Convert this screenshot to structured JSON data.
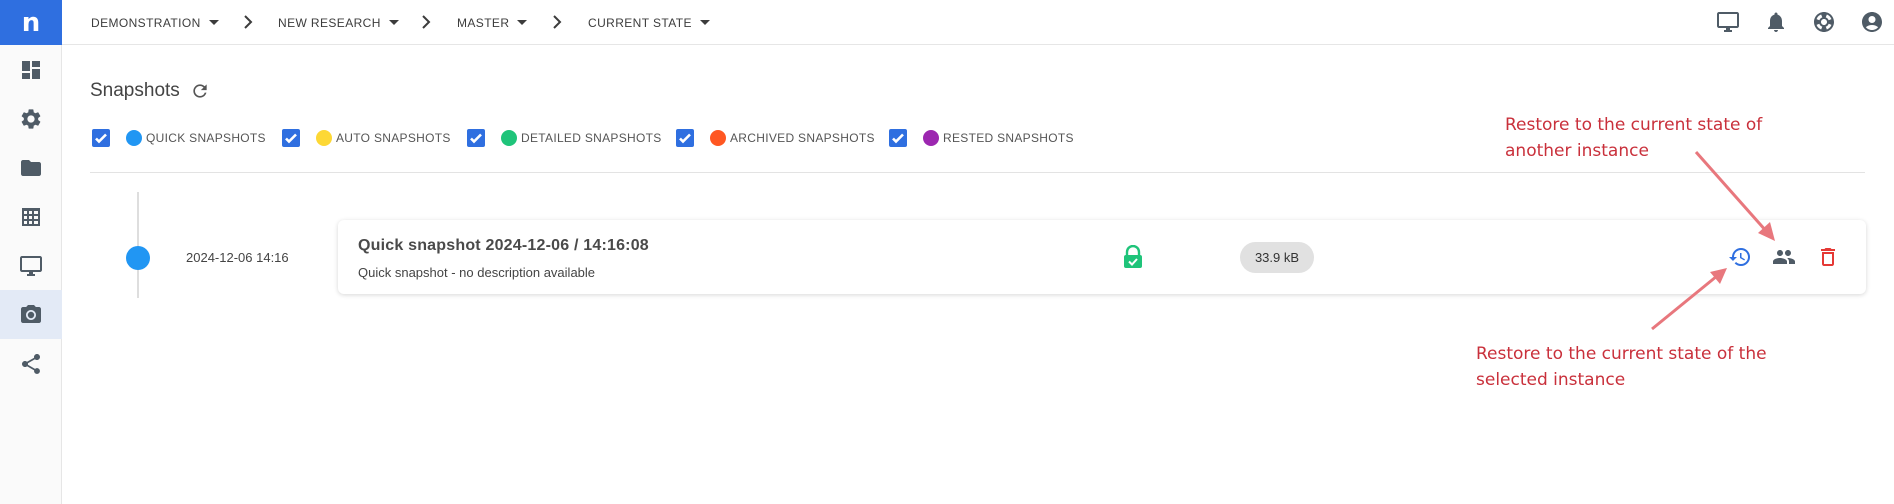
{
  "logo": {
    "letter": "n"
  },
  "sidebar": {
    "items": [
      {
        "icon": "dashboard-icon"
      },
      {
        "icon": "gear-icon"
      },
      {
        "icon": "folder-icon"
      },
      {
        "icon": "table-icon"
      },
      {
        "icon": "monitor-icon"
      },
      {
        "icon": "camera-icon",
        "active": true
      },
      {
        "icon": "share-icon"
      }
    ]
  },
  "breadcrumb": {
    "items": [
      {
        "label": "DEMONSTRATION"
      },
      {
        "label": "NEW RESEARCH"
      },
      {
        "label": "MASTER"
      },
      {
        "label": "CURRENT STATE"
      }
    ]
  },
  "topbar_icons": [
    "monitor-icon",
    "bell-icon",
    "lifebuoy-icon",
    "account-icon"
  ],
  "page": {
    "title": "Snapshots"
  },
  "filters": [
    {
      "label": "QUICK SNAPSHOTS",
      "color": "#2196f3",
      "checked": true
    },
    {
      "label": "AUTO SNAPSHOTS",
      "color": "#fdd835",
      "checked": true
    },
    {
      "label": "DETAILED SNAPSHOTS",
      "color": "#1fc47a",
      "checked": true
    },
    {
      "label": "ARCHIVED SNAPSHOTS",
      "color": "#ff5722",
      "checked": true
    },
    {
      "label": "RESTED SNAPSHOTS",
      "color": "#9c27b0",
      "checked": true
    }
  ],
  "snapshot": {
    "date": "2024-12-06 14:16",
    "title": "Quick snapshot 2024-12-06 / 14:16:08",
    "description": "Quick snapshot - no description available",
    "size": "33.9 kB",
    "dot_color": "#2196f3"
  },
  "annotations": {
    "top_line1": "Restore to the current state of",
    "top_line2": "another instance",
    "bottom_line1": "Restore to the current state of the",
    "bottom_line2": "selected instance"
  },
  "colors": {
    "accent": "#2f6fe0",
    "annotation": "#c9303b",
    "lock": "#1fc47a",
    "delete": "#e53935"
  }
}
